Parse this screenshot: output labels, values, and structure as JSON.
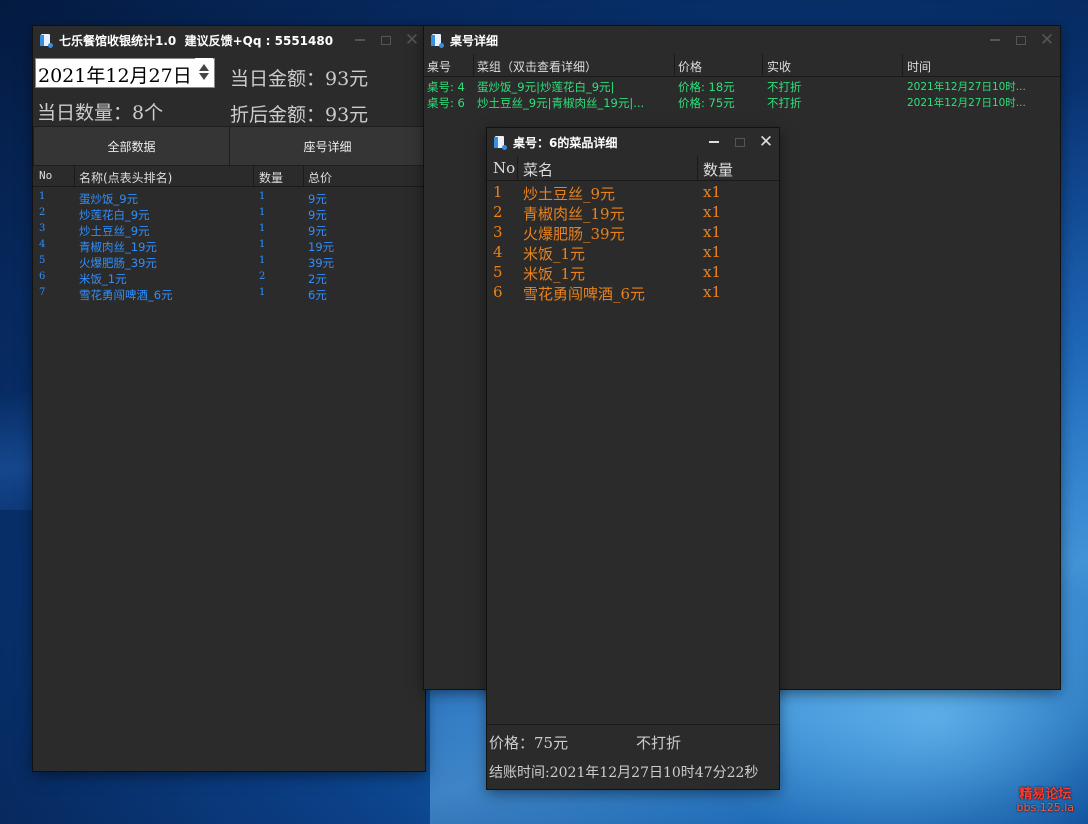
{
  "main_window": {
    "title": "七乐餐馆收银统计1.0  建议反馈+Qq : 5551480",
    "date_value": "2021年12月27日",
    "daily_amount": "当日金额：93元",
    "daily_count": "当日数量：8个",
    "discount_amount": "折后金额：93元",
    "btn_all": "全部数据",
    "btn_seat": "座号详细",
    "table_headers": [
      "No",
      "名称(点表头排名)",
      "数量",
      "总价"
    ],
    "rows": [
      {
        "no": "1",
        "name": "蛋炒饭_9元",
        "qty": "1",
        "total": "9元"
      },
      {
        "no": "2",
        "name": "炒莲花白_9元",
        "qty": "1",
        "total": "9元"
      },
      {
        "no": "3",
        "name": "炒土豆丝_9元",
        "qty": "1",
        "total": "9元"
      },
      {
        "no": "4",
        "name": "青椒肉丝_19元",
        "qty": "1",
        "total": "19元"
      },
      {
        "no": "5",
        "name": "火爆肥肠_39元",
        "qty": "1",
        "total": "39元"
      },
      {
        "no": "6",
        "name": "米饭_1元",
        "qty": "2",
        "total": "2元"
      },
      {
        "no": "7",
        "name": "雪花勇闯啤酒_6元",
        "qty": "1",
        "total": "6元"
      }
    ]
  },
  "table_window": {
    "title": "桌号详细",
    "headers": [
      "桌号",
      "菜组（双击查看详细）",
      "价格",
      "实收",
      "时间"
    ],
    "rows": [
      {
        "table": "桌号: 4",
        "dishes": "蛋炒饭_9元|炒莲花白_9元|",
        "price": "价格: 18元",
        "paid": "不打折",
        "time": "2021年12月27日10时..."
      },
      {
        "table": "桌号: 6",
        "dishes": "炒土豆丝_9元|青椒肉丝_19元|...",
        "price": "价格: 75元",
        "paid": "不打折",
        "time": "2021年12月27日10时..."
      }
    ]
  },
  "detail_window": {
    "title": "桌号：6的菜品详细",
    "headers": [
      "No",
      "菜名",
      "数量"
    ],
    "rows": [
      {
        "no": "1",
        "name": "炒土豆丝_9元",
        "qty": "x1"
      },
      {
        "no": "2",
        "name": "青椒肉丝_19元",
        "qty": "x1"
      },
      {
        "no": "3",
        "name": "火爆肥肠_39元",
        "qty": "x1"
      },
      {
        "no": "4",
        "name": "米饭_1元",
        "qty": "x1"
      },
      {
        "no": "5",
        "name": "米饭_1元",
        "qty": "x1"
      },
      {
        "no": "6",
        "name": "雪花勇闯啤酒_6元",
        "qty": "x1"
      }
    ],
    "price_label": "价格：75元",
    "discount_label": "不打折",
    "checkout_time": "结账时间:2021年12月27日10时47分22秒"
  },
  "watermark": {
    "line1": "精易论坛",
    "line2": "bbs.125.la"
  },
  "colors": {
    "list_blue": "#2f8fff",
    "list_green": "#2ee07a",
    "list_orange": "#e8821e",
    "bg": "#2b2b2b"
  }
}
